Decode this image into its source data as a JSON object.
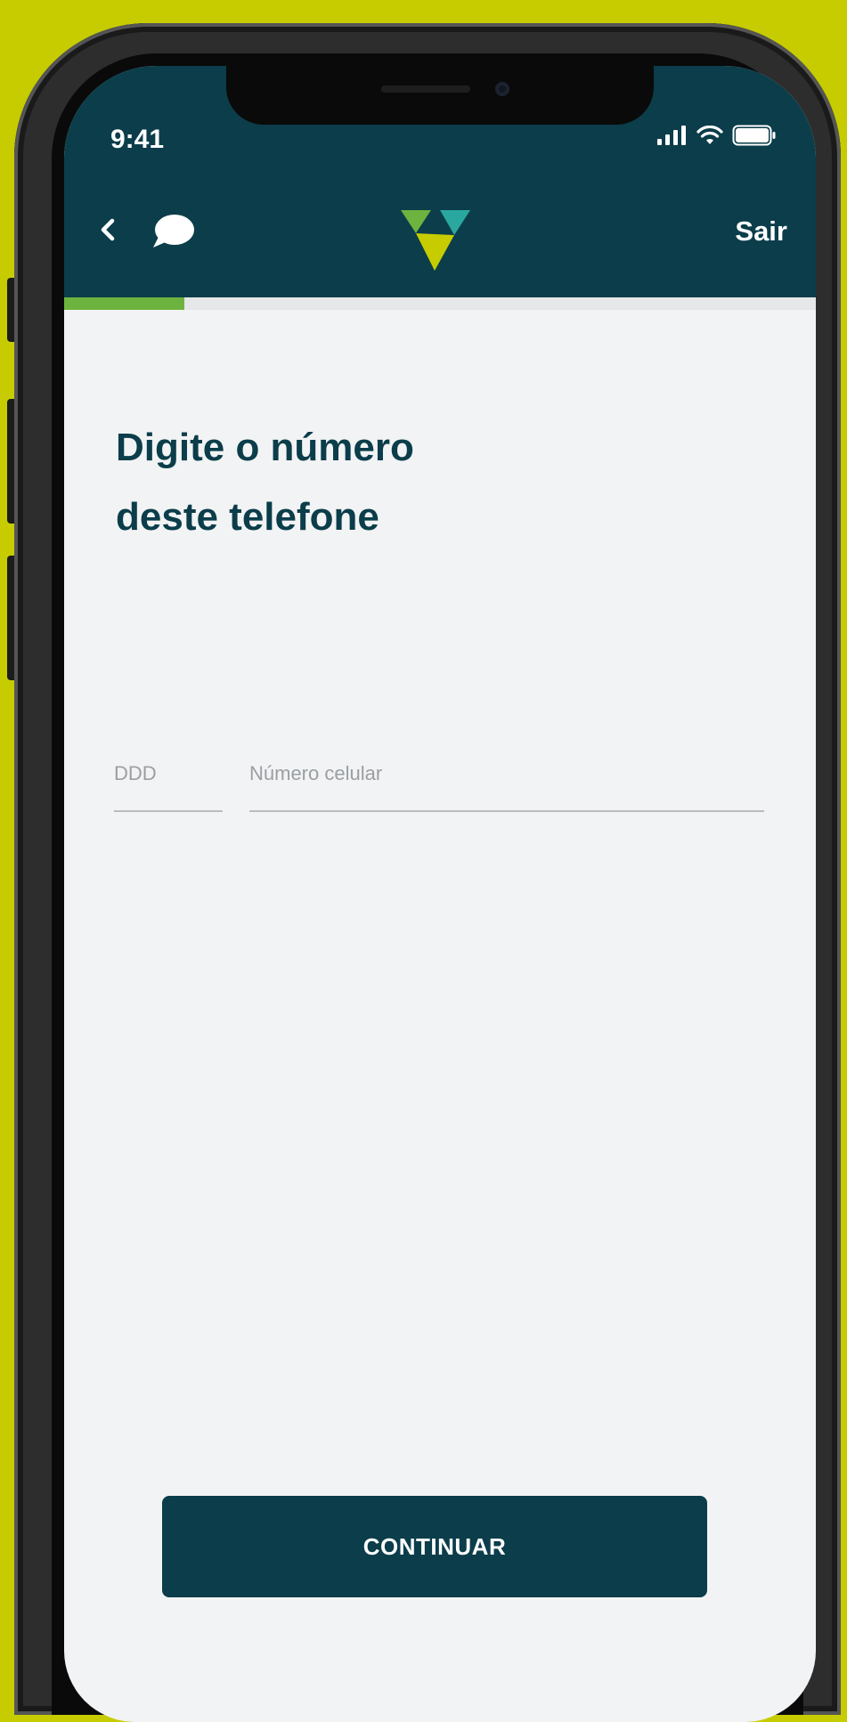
{
  "status_bar": {
    "time": "9:41",
    "icons": [
      "signal-icon",
      "wifi-icon",
      "battery-icon"
    ]
  },
  "header": {
    "back_icon": "chevron-left-icon",
    "chat_icon": "chat-bubble-icon",
    "logo": "app-logo",
    "logout_label": "Sair"
  },
  "progress": {
    "fraction": 0.16
  },
  "main": {
    "title_line1": "Digite o número",
    "title_line2": "deste telefone",
    "ddd_label": "DDD",
    "phone_label": "Número celular"
  },
  "footer": {
    "continue_label": "CONTINUAR"
  },
  "colors": {
    "background": "#c7cc00",
    "header": "#0b3d4a",
    "accent": "#6db33f",
    "screen": "#f2f3f4"
  }
}
